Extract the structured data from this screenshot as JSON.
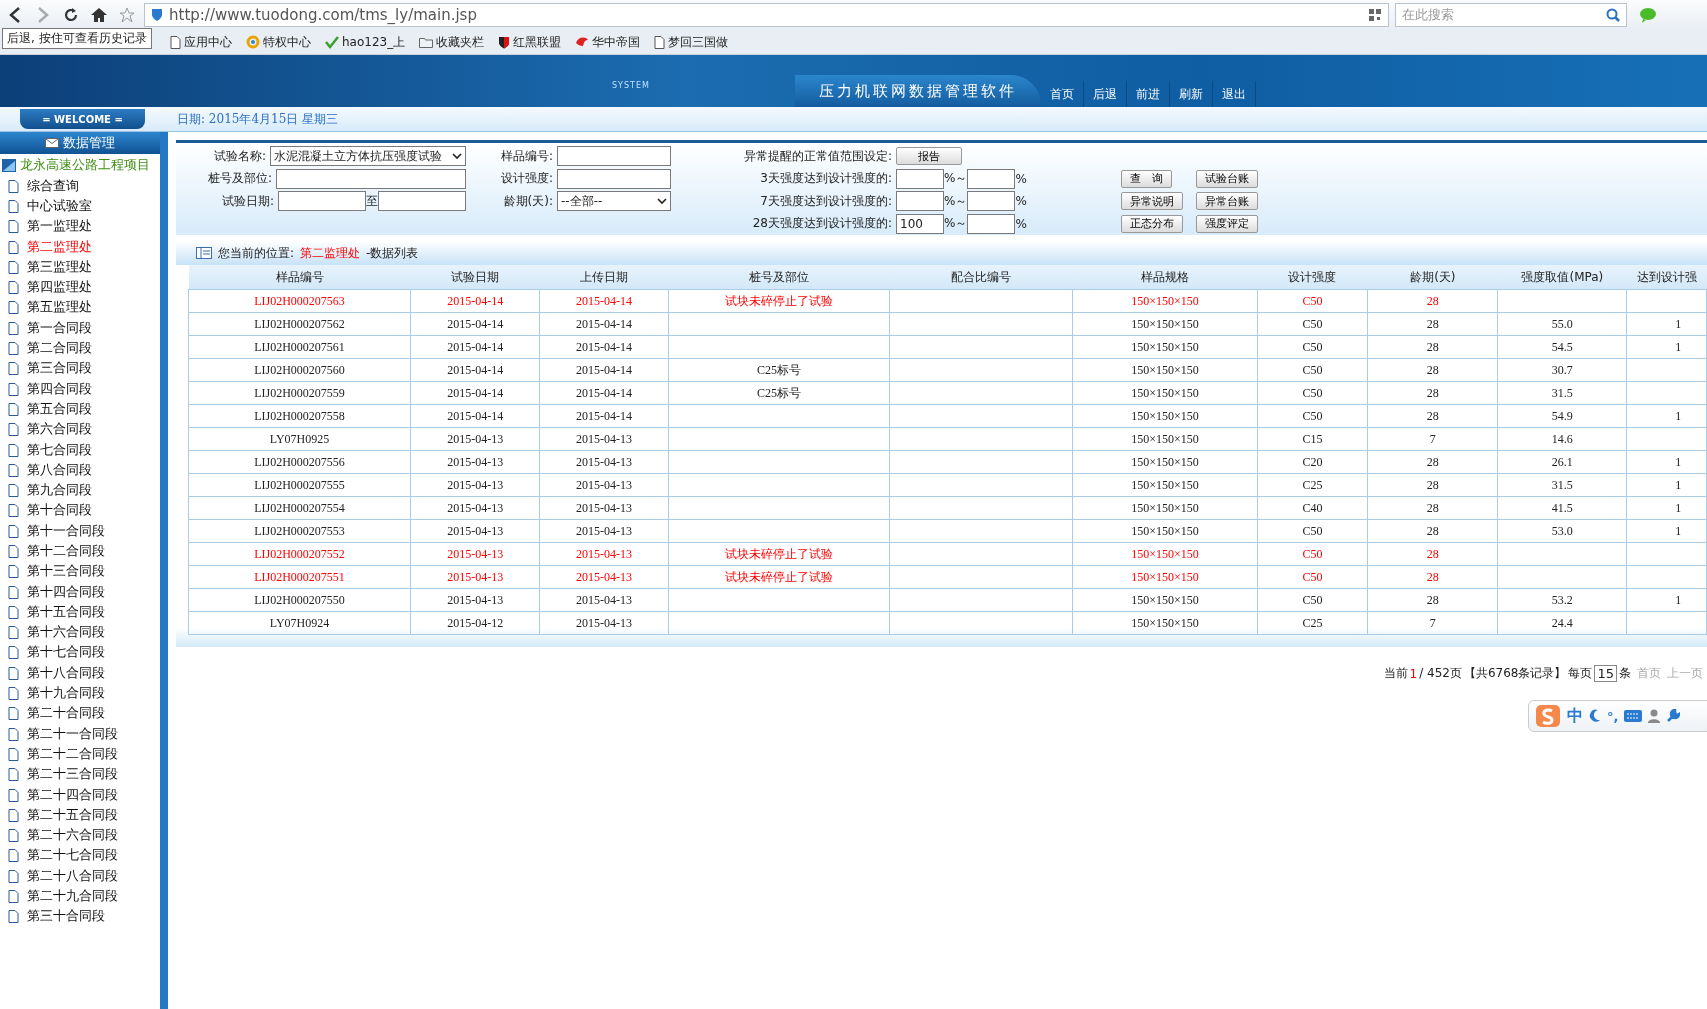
{
  "browser": {
    "back_tooltip": "后退, 按住可查看历史记录",
    "url": "http://www.tuodong.com/tms_ly/main.jsp",
    "search_placeholder": "在此搜索",
    "bookmarks": [
      {
        "label": "应用中心",
        "kind": "page"
      },
      {
        "label": "特权中心",
        "kind": "ring"
      },
      {
        "label": "hao123_上",
        "kind": "hao"
      },
      {
        "label": "收藏夹栏",
        "kind": "folder"
      },
      {
        "label": "红黑联盟",
        "kind": "shield"
      },
      {
        "label": "华中帝国",
        "kind": "bird"
      },
      {
        "label": "梦回三国做",
        "kind": "page"
      }
    ]
  },
  "header": {
    "system_label": "SYSTEM",
    "title": "压力机联网数据管理软件",
    "nav": [
      "首页",
      "后退",
      "前进",
      "刷新",
      "退出"
    ]
  },
  "welcome": "= WELCOME =",
  "date": "日期: 2015年4月15日  星期三",
  "sidebar": {
    "title": "数据管理",
    "project": "龙永高速公路工程项目",
    "items": [
      {
        "label": "综合查询",
        "selected": false
      },
      {
        "label": "中心试验室",
        "selected": false
      },
      {
        "label": "第一监理处",
        "selected": false
      },
      {
        "label": "第二监理处",
        "selected": true
      },
      {
        "label": "第三监理处",
        "selected": false
      },
      {
        "label": "第四监理处",
        "selected": false
      },
      {
        "label": "第五监理处",
        "selected": false
      },
      {
        "label": "第一合同段",
        "selected": false
      },
      {
        "label": "第二合同段",
        "selected": false
      },
      {
        "label": "第三合同段",
        "selected": false
      },
      {
        "label": "第四合同段",
        "selected": false
      },
      {
        "label": "第五合同段",
        "selected": false
      },
      {
        "label": "第六合同段",
        "selected": false
      },
      {
        "label": "第七合同段",
        "selected": false
      },
      {
        "label": "第八合同段",
        "selected": false
      },
      {
        "label": "第九合同段",
        "selected": false
      },
      {
        "label": "第十合同段",
        "selected": false
      },
      {
        "label": "第十一合同段",
        "selected": false
      },
      {
        "label": "第十二合同段",
        "selected": false
      },
      {
        "label": "第十三合同段",
        "selected": false
      },
      {
        "label": "第十四合同段",
        "selected": false
      },
      {
        "label": "第十五合同段",
        "selected": false
      },
      {
        "label": "第十六合同段",
        "selected": false
      },
      {
        "label": "第十七合同段",
        "selected": false
      },
      {
        "label": "第十八合同段",
        "selected": false
      },
      {
        "label": "第十九合同段",
        "selected": false
      },
      {
        "label": "第二十合同段",
        "selected": false
      },
      {
        "label": "第二十一合同段",
        "selected": false
      },
      {
        "label": "第二十二合同段",
        "selected": false
      },
      {
        "label": "第二十三合同段",
        "selected": false
      },
      {
        "label": "第二十四合同段",
        "selected": false
      },
      {
        "label": "第二十五合同段",
        "selected": false
      },
      {
        "label": "第二十六合同段",
        "selected": false
      },
      {
        "label": "第二十七合同段",
        "selected": false
      },
      {
        "label": "第二十八合同段",
        "selected": false
      },
      {
        "label": "第二十九合同段",
        "selected": false
      },
      {
        "label": "第三十合同段",
        "selected": false
      }
    ]
  },
  "form": {
    "test_name": {
      "label": "试验名称:",
      "value": "水泥混凝土立方体抗压强度试验"
    },
    "pile": {
      "label": "桩号及部位:"
    },
    "date": {
      "label": "试验日期:",
      "separator": "至"
    },
    "sample_no": {
      "label": "样品编号:"
    },
    "design_strength": {
      "label": "设计强度:"
    },
    "age": {
      "label": "龄期(天):",
      "value": "--全部--"
    },
    "range_title": "异常提醒的正常值范围设定:",
    "report_button": "报告",
    "ranges": [
      {
        "label": "3天强度达到设计强度的:",
        "from_suffix": "%～",
        "to_suffix": "%"
      },
      {
        "label": "7天强度达到设计强度的:",
        "from_suffix": "%～",
        "to_suffix": "%"
      },
      {
        "label": "28天强度达到设计强度的:",
        "value": "100",
        "from_suffix": "%～",
        "to_suffix": "%"
      }
    ],
    "buttons": [
      "查　询",
      "试验台账",
      "异常说明",
      "异常台账",
      "正态分布",
      "强度评定"
    ]
  },
  "location": {
    "label": "您当前的位置:",
    "current": "第二监理处",
    "suffix": "-数据列表"
  },
  "table": {
    "columns": [
      "样品编号",
      "试验日期",
      "上传日期",
      "桩号及部位",
      "配合比编号",
      "样品规格",
      "设计强度",
      "龄期(天)",
      "强度取值(MPa)",
      "达到设计强"
    ],
    "rows": [
      {
        "abnormal": true,
        "cells": [
          "LIJ02H000207563",
          "2015-04-14",
          "2015-04-14",
          "试块未碎停止了试验",
          "",
          "150×150×150",
          "C50",
          "28",
          "",
          ""
        ]
      },
      {
        "abnormal": false,
        "cells": [
          "LIJ02H000207562",
          "2015-04-14",
          "2015-04-14",
          "",
          "",
          "150×150×150",
          "C50",
          "28",
          "55.0",
          "1"
        ]
      },
      {
        "abnormal": false,
        "cells": [
          "LIJ02H000207561",
          "2015-04-14",
          "2015-04-14",
          "",
          "",
          "150×150×150",
          "C50",
          "28",
          "54.5",
          "1"
        ]
      },
      {
        "abnormal": false,
        "cells": [
          "LIJ02H000207560",
          "2015-04-14",
          "2015-04-14",
          "C25标号",
          "",
          "150×150×150",
          "C50",
          "28",
          "30.7",
          ""
        ]
      },
      {
        "abnormal": false,
        "cells": [
          "LIJ02H000207559",
          "2015-04-14",
          "2015-04-14",
          "C25标号",
          "",
          "150×150×150",
          "C50",
          "28",
          "31.5",
          ""
        ]
      },
      {
        "abnormal": false,
        "cells": [
          "LIJ02H000207558",
          "2015-04-14",
          "2015-04-14",
          "",
          "",
          "150×150×150",
          "C50",
          "28",
          "54.9",
          "1"
        ]
      },
      {
        "abnormal": false,
        "cells": [
          "LY07H0925",
          "2015-04-13",
          "2015-04-13",
          "",
          "",
          "150×150×150",
          "C15",
          "7",
          "14.6",
          ""
        ]
      },
      {
        "abnormal": false,
        "cells": [
          "LIJ02H000207556",
          "2015-04-13",
          "2015-04-13",
          "",
          "",
          "150×150×150",
          "C20",
          "28",
          "26.1",
          "1"
        ]
      },
      {
        "abnormal": false,
        "cells": [
          "LIJ02H000207555",
          "2015-04-13",
          "2015-04-13",
          "",
          "",
          "150×150×150",
          "C25",
          "28",
          "31.5",
          "1"
        ]
      },
      {
        "abnormal": false,
        "cells": [
          "LIJ02H000207554",
          "2015-04-13",
          "2015-04-13",
          "",
          "",
          "150×150×150",
          "C40",
          "28",
          "41.5",
          "1"
        ]
      },
      {
        "abnormal": false,
        "cells": [
          "LIJ02H000207553",
          "2015-04-13",
          "2015-04-13",
          "",
          "",
          "150×150×150",
          "C50",
          "28",
          "53.0",
          "1"
        ]
      },
      {
        "abnormal": true,
        "cells": [
          "LIJ02H000207552",
          "2015-04-13",
          "2015-04-13",
          "试块未碎停止了试验",
          "",
          "150×150×150",
          "C50",
          "28",
          "",
          ""
        ]
      },
      {
        "abnormal": true,
        "cells": [
          "LIJ02H000207551",
          "2015-04-13",
          "2015-04-13",
          "试块未碎停止了试验",
          "",
          "150×150×150",
          "C50",
          "28",
          "",
          ""
        ]
      },
      {
        "abnormal": false,
        "cells": [
          "LIJ02H000207550",
          "2015-04-13",
          "2015-04-13",
          "",
          "",
          "150×150×150",
          "C50",
          "28",
          "53.2",
          "1"
        ]
      },
      {
        "abnormal": false,
        "cells": [
          "LY07H0924",
          "2015-04-12",
          "2015-04-13",
          "",
          "",
          "150×150×150",
          "C25",
          "7",
          "24.4",
          ""
        ]
      }
    ]
  },
  "pagination": {
    "prefix": "当前",
    "page": "1",
    "pages": "/ 452页",
    "records": "【共6768条记录】",
    "per_page_label": "每页",
    "per_page": "15",
    "per_page_unit": "条",
    "links": [
      "首页",
      "上一页"
    ]
  },
  "ime": {
    "mode": "中",
    "punct": "°,"
  }
}
